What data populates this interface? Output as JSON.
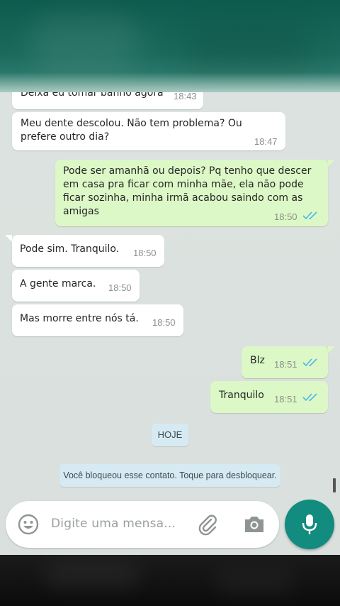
{
  "messages": [
    {
      "dir": "in",
      "text": "Deixa eu tomar banho agora",
      "time": "18:43"
    },
    {
      "dir": "in",
      "text": "Meu dente descolou. Não tem problema? Ou prefere outro dia?",
      "time": "18:47"
    },
    {
      "dir": "out",
      "text": "Pode ser amanhã ou depois? Pq tenho que descer em casa pra ficar com minha mãe, ela não pode ficar sozinha, minha irmã acabou saindo com as amigas",
      "time": "18:50"
    },
    {
      "dir": "in",
      "text": "Pode sim. Tranquilo.",
      "time": "18:50"
    },
    {
      "dir": "in",
      "text": "A gente marca.",
      "time": "18:50"
    },
    {
      "dir": "in",
      "text": "Mas morre entre nós tá.",
      "time": "18:50"
    },
    {
      "dir": "out",
      "text": "Blz",
      "time": "18:51"
    },
    {
      "dir": "out",
      "text": "Tranquilo",
      "time": "18:51"
    }
  ],
  "day_label": "HOJE",
  "system_message": "Você bloqueou esse contato. Toque para desbloquear.",
  "composer": {
    "placeholder": "Digite uma mensa...",
    "icons": [
      "emoji-icon",
      "attach-icon",
      "camera-icon",
      "mic-icon"
    ]
  },
  "colors": {
    "header": "#0e5b4e",
    "incoming": "#ffffff",
    "outgoing": "#dcf8c6",
    "read_ticks": "#4fb6ec",
    "mic_button": "#128c7e"
  }
}
